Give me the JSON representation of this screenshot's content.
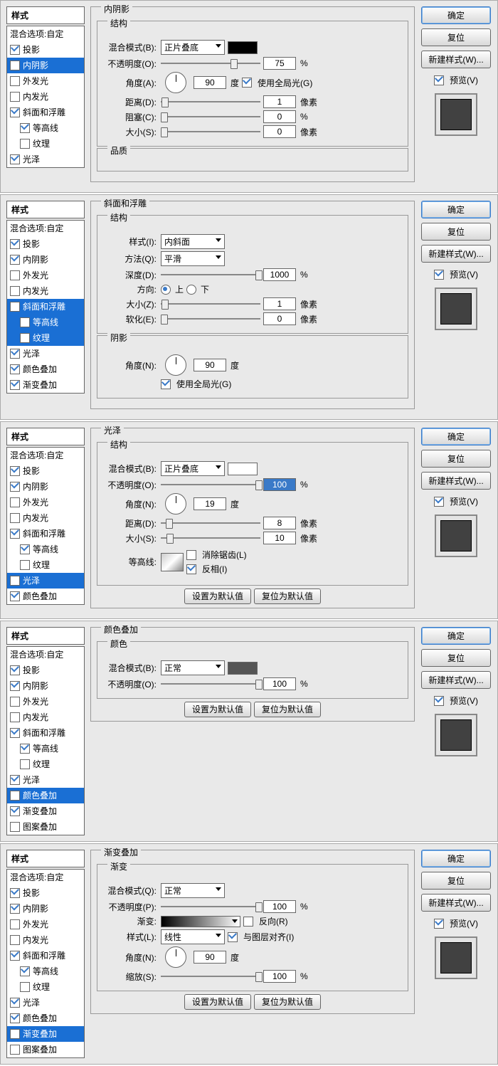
{
  "common": {
    "styles_header": "样式",
    "blending_options": "混合选项:自定",
    "ok": "确定",
    "cancel": "复位",
    "new_style": "新建样式(W)...",
    "preview": "预览(V)",
    "blend_mode_label": "混合模式(B):",
    "opacity_label": "不透明度(O):",
    "structure_label": "结构",
    "px": "像素",
    "pct": "%",
    "deg": "度",
    "set_default": "设置为默认值",
    "reset_default": "复位为默认值",
    "use_global": "使用全局光(G)"
  },
  "effects_catalog": {
    "drop_shadow": "投影",
    "inner_shadow": "内阴影",
    "outer_glow": "外发光",
    "inner_glow": "内发光",
    "bevel": "斜面和浮雕",
    "contour": "等高线",
    "texture": "纹理",
    "satin": "光泽",
    "color_overlay": "颜色叠加",
    "gradient_overlay": "渐变叠加",
    "pattern_overlay": "图案叠加"
  },
  "panels": [
    {
      "id": "inner_shadow",
      "title": "内阴影",
      "list": [
        {
          "k": "drop_shadow",
          "on": true
        },
        {
          "k": "inner_shadow",
          "on": true,
          "sel": true
        },
        {
          "k": "outer_glow",
          "on": false
        },
        {
          "k": "inner_glow",
          "on": false
        },
        {
          "k": "bevel",
          "on": true
        },
        {
          "k": "contour",
          "on": true,
          "sub": true
        },
        {
          "k": "texture",
          "on": false,
          "sub": true
        },
        {
          "k": "satin",
          "on": true
        }
      ],
      "content": {
        "blend_mode": "正片叠底",
        "swatch": "#000000",
        "opacity": "75",
        "angle_label": "角度(A):",
        "angle": "90",
        "use_global": true,
        "distance_label": "距离(D):",
        "distance": "1",
        "choke_label": "阻塞(C):",
        "choke": "0",
        "size_label": "大小(S):",
        "size": "0",
        "quality_label": "品质"
      }
    },
    {
      "id": "bevel",
      "title": "斜面和浮雕",
      "list": [
        {
          "k": "drop_shadow",
          "on": true
        },
        {
          "k": "inner_shadow",
          "on": true
        },
        {
          "k": "outer_glow",
          "on": false
        },
        {
          "k": "inner_glow",
          "on": false
        },
        {
          "k": "bevel",
          "on": true,
          "sel": true
        },
        {
          "k": "contour",
          "on": true,
          "sub": true,
          "sel": true
        },
        {
          "k": "texture",
          "on": false,
          "sub": true,
          "sel": true
        },
        {
          "k": "satin",
          "on": true
        },
        {
          "k": "color_overlay",
          "on": true
        },
        {
          "k": "gradient_overlay",
          "on": true
        }
      ],
      "content": {
        "style_label": "样式(I):",
        "style_val": "内斜面",
        "technique_label": "方法(Q):",
        "technique_val": "平滑",
        "depth_label": "深度(D):",
        "depth": "1000",
        "direction_label": "方向:",
        "up": "上",
        "down": "下",
        "size_label": "大小(Z):",
        "size": "1",
        "soften_label": "软化(E):",
        "soften": "0",
        "shading_label": "阴影",
        "angle_label": "角度(N):",
        "angle": "90",
        "use_global": true
      }
    },
    {
      "id": "satin",
      "title": "光泽",
      "list": [
        {
          "k": "drop_shadow",
          "on": true
        },
        {
          "k": "inner_shadow",
          "on": true
        },
        {
          "k": "outer_glow",
          "on": false
        },
        {
          "k": "inner_glow",
          "on": false
        },
        {
          "k": "bevel",
          "on": true
        },
        {
          "k": "contour",
          "on": true,
          "sub": true
        },
        {
          "k": "texture",
          "on": false,
          "sub": true
        },
        {
          "k": "satin",
          "on": true,
          "sel": true
        },
        {
          "k": "color_overlay",
          "on": true
        }
      ],
      "content": {
        "blend_mode": "正片叠底",
        "swatch": "#ffffff",
        "opacity": "100",
        "opacity_sel": true,
        "angle_label": "角度(N):",
        "angle": "19",
        "distance_label": "距离(D):",
        "distance": "8",
        "size_label": "大小(S):",
        "size": "10",
        "contour_label": "等高线:",
        "anti_alias": "消除锯齿(L)",
        "invert": "反相(I)"
      }
    },
    {
      "id": "color_overlay",
      "title": "颜色叠加",
      "inner_title": "颜色",
      "list": [
        {
          "k": "drop_shadow",
          "on": true
        },
        {
          "k": "inner_shadow",
          "on": true
        },
        {
          "k": "outer_glow",
          "on": false
        },
        {
          "k": "inner_glow",
          "on": false
        },
        {
          "k": "bevel",
          "on": true
        },
        {
          "k": "contour",
          "on": true,
          "sub": true
        },
        {
          "k": "texture",
          "on": false,
          "sub": true
        },
        {
          "k": "satin",
          "on": true
        },
        {
          "k": "color_overlay",
          "on": true,
          "sel": true
        },
        {
          "k": "gradient_overlay",
          "on": true
        },
        {
          "k": "pattern_overlay",
          "on": false
        }
      ],
      "content": {
        "blend_mode": "正常",
        "swatch": "#555555",
        "opacity": "100"
      }
    },
    {
      "id": "gradient_overlay",
      "title": "渐变叠加",
      "inner_title": "渐变",
      "list": [
        {
          "k": "drop_shadow",
          "on": true
        },
        {
          "k": "inner_shadow",
          "on": true
        },
        {
          "k": "outer_glow",
          "on": false
        },
        {
          "k": "inner_glow",
          "on": false
        },
        {
          "k": "bevel",
          "on": true
        },
        {
          "k": "contour",
          "on": true,
          "sub": true
        },
        {
          "k": "texture",
          "on": false,
          "sub": true
        },
        {
          "k": "satin",
          "on": true
        },
        {
          "k": "color_overlay",
          "on": true
        },
        {
          "k": "gradient_overlay",
          "on": true,
          "sel": true
        },
        {
          "k": "pattern_overlay",
          "on": false
        }
      ],
      "content": {
        "blend_mode_label": "混合模式(Q):",
        "blend_mode": "正常",
        "opacity_label": "不透明度(P):",
        "opacity": "100",
        "gradient_label": "渐变:",
        "reverse": "反向(R)",
        "style_label": "样式(L):",
        "style_val": "线性",
        "align": "与图层对齐(I)",
        "angle_label": "角度(N):",
        "angle": "90",
        "scale_label": "缩放(S):",
        "scale": "100"
      }
    }
  ]
}
